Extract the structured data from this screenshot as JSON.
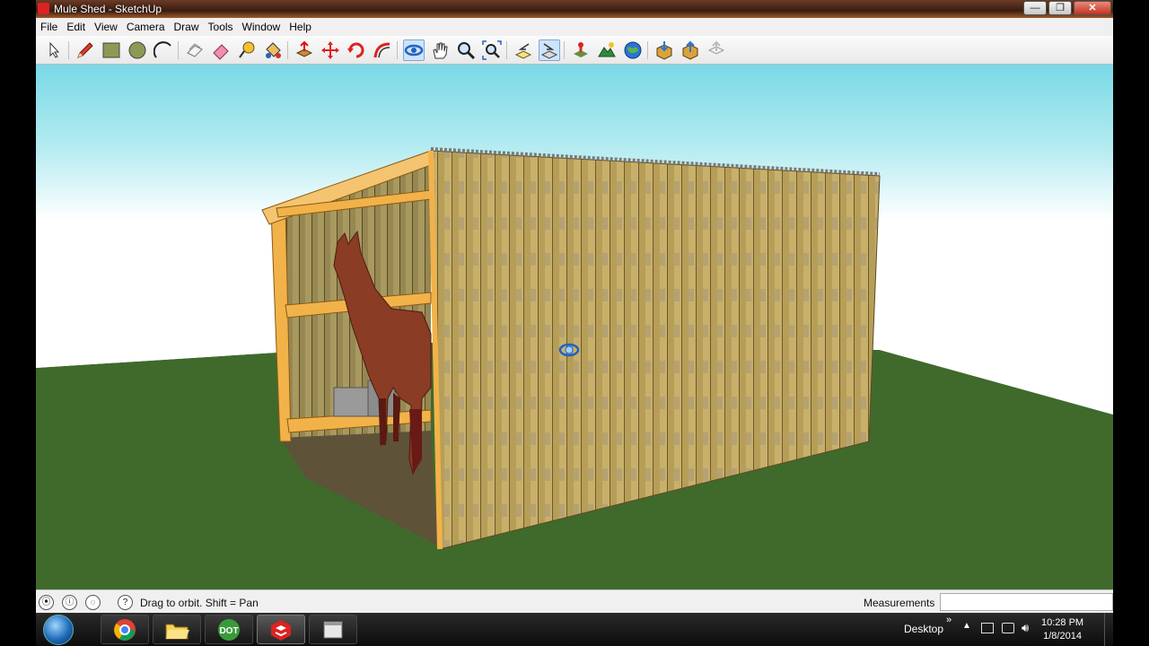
{
  "window": {
    "title": "Mule Shed - SketchUp",
    "buttons": {
      "minimize": "—",
      "maximize": "❐",
      "close": "✕"
    }
  },
  "menu": [
    "File",
    "Edit",
    "View",
    "Camera",
    "Draw",
    "Tools",
    "Window",
    "Help"
  ],
  "toolbar": {
    "tools": [
      {
        "name": "select-tool",
        "icon": "arrow-icon"
      },
      {
        "name": "pencil-tool",
        "icon": "pencil-icon"
      },
      {
        "name": "rectangle-tool",
        "icon": "rectangle-icon"
      },
      {
        "name": "circle-tool",
        "icon": "circle-icon"
      },
      {
        "name": "arc-tool",
        "icon": "arc-icon"
      },
      {
        "name": "make-component-tool",
        "icon": "component-icon"
      },
      {
        "name": "eraser-tool",
        "icon": "eraser-icon"
      },
      {
        "name": "tape-measure-tool",
        "icon": "tape-measure-icon"
      },
      {
        "name": "paint-bucket-tool",
        "icon": "paint-bucket-icon"
      },
      {
        "name": "push-pull-tool",
        "icon": "push-pull-icon"
      },
      {
        "name": "move-tool",
        "icon": "move-icon"
      },
      {
        "name": "rotate-tool",
        "icon": "rotate-icon"
      },
      {
        "name": "offset-tool",
        "icon": "offset-icon"
      },
      {
        "name": "orbit-tool",
        "icon": "orbit-icon"
      },
      {
        "name": "pan-tool",
        "icon": "hand-icon"
      },
      {
        "name": "zoom-tool",
        "icon": "magnifier-icon"
      },
      {
        "name": "zoom-extents-tool",
        "icon": "zoom-extents-icon"
      },
      {
        "name": "previous-view-tool",
        "icon": "previous-view-icon"
      },
      {
        "name": "next-view-tool",
        "icon": "next-view-icon"
      },
      {
        "name": "add-location-tool",
        "icon": "location-icon"
      },
      {
        "name": "toggle-terrain-tool",
        "icon": "terrain-icon"
      },
      {
        "name": "preview-google-earth-tool",
        "icon": "globe-icon"
      },
      {
        "name": "get-models-tool",
        "icon": "get-models-icon"
      },
      {
        "name": "share-model-tool",
        "icon": "share-model-icon"
      },
      {
        "name": "share-component-tool",
        "icon": "share-component-icon"
      }
    ]
  },
  "status": {
    "hint": "Drag to orbit.  Shift = Pan",
    "measurements_label": "Measurements",
    "measurements_value": ""
  },
  "taskbar": {
    "apps": [
      {
        "name": "chrome",
        "icon": "chrome-icon"
      },
      {
        "name": "file-explorer",
        "icon": "folder-icon"
      },
      {
        "name": "dot-app",
        "label": "DOT",
        "icon": "dot-icon"
      },
      {
        "name": "sketchup",
        "icon": "sketchup-icon"
      },
      {
        "name": "window-app",
        "icon": "window-icon"
      }
    ],
    "desktop_label": "Desktop",
    "chevron": "»",
    "time": "10:28 PM",
    "date": "1/8/2014"
  },
  "colors": {
    "sky_top": "#79d9e6",
    "sky_horizon": "#ffffff",
    "grass": "#3f6a2c",
    "wood": "#c3a85e",
    "frame_wood": "#f2b24a",
    "horse": "#8a3c24"
  }
}
